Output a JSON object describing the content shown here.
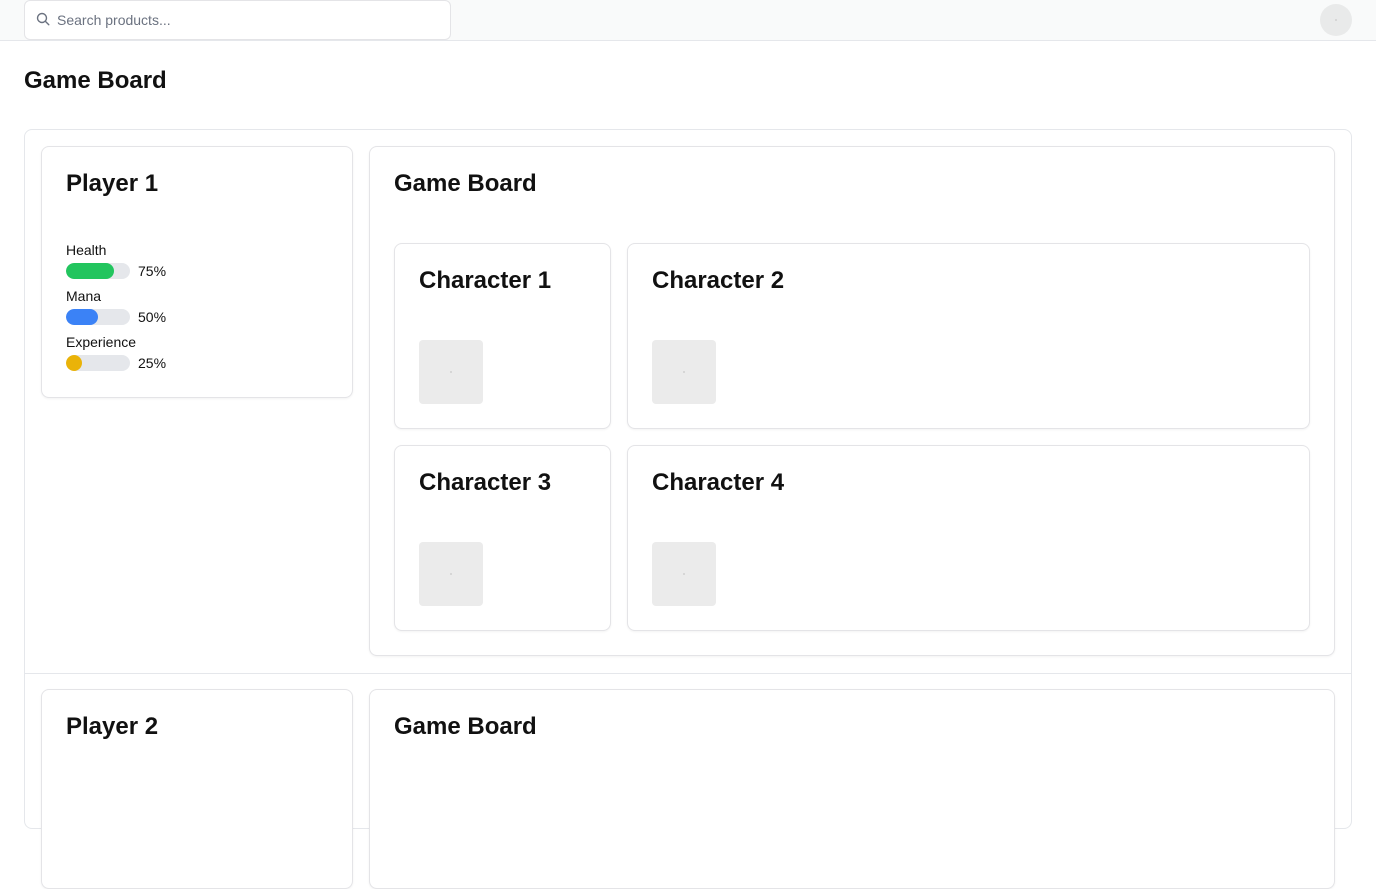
{
  "header": {
    "search_placeholder": "Search products...",
    "search_icon": "search-icon",
    "avatar_icon": "user-avatar"
  },
  "page": {
    "title": "Game Board"
  },
  "colors": {
    "health": "#22c55e",
    "mana": "#3b82f6",
    "experience": "#eab308",
    "track": "#e5e7eb"
  },
  "rows": [
    {
      "player": {
        "name": "Player 1",
        "stats": [
          {
            "label": "Health",
            "value": 75,
            "text": "75%"
          },
          {
            "label": "Mana",
            "value": 50,
            "text": "50%"
          },
          {
            "label": "Experience",
            "value": 25,
            "text": "25%"
          }
        ]
      },
      "board": {
        "title": "Game Board",
        "characters": [
          {
            "name": "Character 1"
          },
          {
            "name": "Character 2"
          },
          {
            "name": "Character 3"
          },
          {
            "name": "Character 4"
          }
        ]
      }
    },
    {
      "player": {
        "name": "Player 2"
      },
      "board": {
        "title": "Game Board"
      }
    }
  ]
}
